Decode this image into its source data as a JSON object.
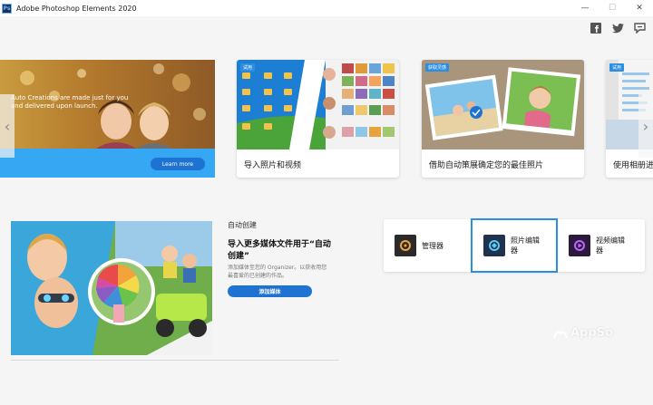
{
  "window": {
    "title": "Adobe Photoshop Elements 2020",
    "app_icon_text": "Ps",
    "minimize": "—",
    "maximize": "☐",
    "close": "✕"
  },
  "social": {
    "facebook_icon": "facebook-icon",
    "twitter_icon": "twitter-icon",
    "chat_icon": "chat-icon"
  },
  "carousel": {
    "prev_arrow": "‹",
    "next_arrow": "›",
    "promo": {
      "text": "Auto Creations are made just for you and delivered upon launch.",
      "button": "Learn more"
    },
    "cards": [
      {
        "label": "导入照片和视频",
        "badge": "试用"
      },
      {
        "label": "借助自动策展确定您的最佳照片",
        "badge": "获取灵感"
      },
      {
        "label": "使用相册进",
        "badge": "试用"
      }
    ]
  },
  "auto": {
    "section_title": "自动创建",
    "heading": "导入更多媒体文件用于“自动创建”",
    "description": "添加媒体至您的 Organizer。以获收用您最喜爱的已创建的作品。",
    "button": "添加媒体"
  },
  "launchers": [
    {
      "label": "管理器",
      "icon": "organizer-icon",
      "color": "#2a2a2a",
      "accent": "#f2a33a"
    },
    {
      "label": "照片编辑器",
      "icon": "photo-editor-icon",
      "color": "#1e3350",
      "accent": "#5ec8f5"
    },
    {
      "label": "视频编辑器",
      "icon": "video-editor-icon",
      "color": "#2b1a3d",
      "accent": "#c065ff"
    }
  ],
  "watermark": "AppSo"
}
